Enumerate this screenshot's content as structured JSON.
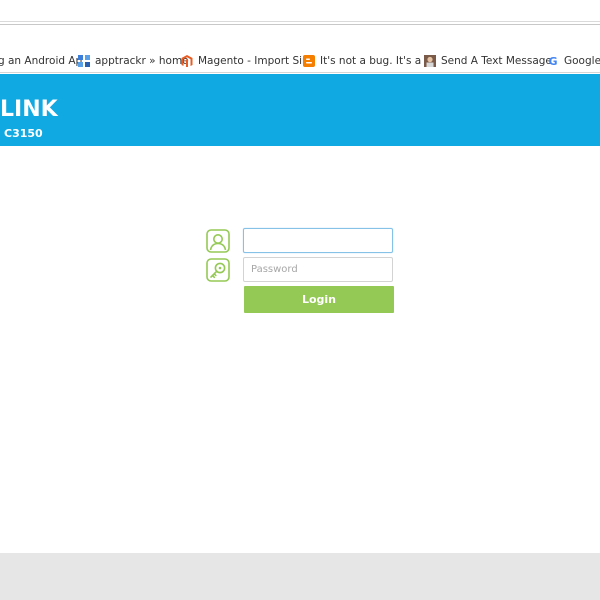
{
  "bookmarks": [
    {
      "label": "g an Android Ap",
      "icon": "android-icon"
    },
    {
      "label": "apptrackr » home",
      "icon": "apptrackr-icon"
    },
    {
      "label": "Magento - Import Sin",
      "icon": "magento-icon"
    },
    {
      "label": "It's not a bug. It's a fe",
      "icon": "blogger-icon"
    },
    {
      "label": "Send A Text Message",
      "icon": "portrait-icon"
    },
    {
      "label": "Google",
      "icon": "google-icon"
    }
  ],
  "header": {
    "brand": "LINK",
    "model": "C3150",
    "color": "#10a9e1"
  },
  "login": {
    "username_value": "",
    "username_placeholder": "",
    "password_value": "",
    "password_placeholder": "Password",
    "button_label": "Login",
    "accent": "#95c955"
  }
}
